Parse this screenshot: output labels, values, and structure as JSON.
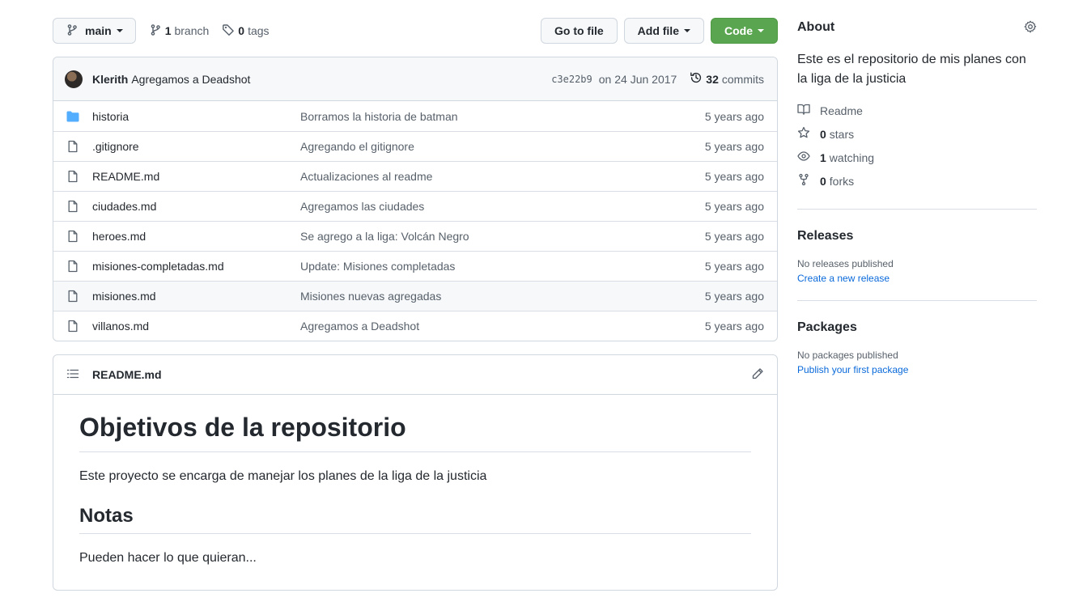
{
  "toolbar": {
    "branch_name": "main",
    "branch_count": "1",
    "branch_label": "branch",
    "tag_count": "0",
    "tag_label": "tags",
    "go_to_file": "Go to file",
    "add_file": "Add file",
    "code": "Code"
  },
  "latest_commit": {
    "author": "Klerith",
    "message": "Agregamos a Deadshot",
    "sha": "c3e22b9",
    "date": "on 24 Jun 2017",
    "commit_count": "32",
    "commit_label": "commits"
  },
  "files": [
    {
      "type": "dir",
      "name": "historia",
      "message": "Borramos la historia de batman",
      "age": "5 years ago"
    },
    {
      "type": "file",
      "name": ".gitignore",
      "message": "Agregando el gitignore",
      "age": "5 years ago"
    },
    {
      "type": "file",
      "name": "README.md",
      "message": "Actualizaciones al readme",
      "age": "5 years ago"
    },
    {
      "type": "file",
      "name": "ciudades.md",
      "message": "Agregamos las ciudades",
      "age": "5 years ago"
    },
    {
      "type": "file",
      "name": "heroes.md",
      "message": "Se agrego a la liga: Volcán Negro",
      "age": "5 years ago"
    },
    {
      "type": "file",
      "name": "misiones-completadas.md",
      "message": "Update: Misiones completadas",
      "age": "5 years ago"
    },
    {
      "type": "file",
      "name": "misiones.md",
      "message": "Misiones nuevas agregadas",
      "age": "5 years ago"
    },
    {
      "type": "file",
      "name": "villanos.md",
      "message": "Agregamos a Deadshot",
      "age": "5 years ago"
    }
  ],
  "readme": {
    "filename": "README.md",
    "h1": "Objetivos de la repositorio",
    "p1": "Este proyecto se encarga de manejar los planes de la liga de la justicia",
    "h2": "Notas",
    "p2": "Pueden hacer lo que quieran..."
  },
  "about": {
    "title": "About",
    "description": "Este es el repositorio de mis planes con la liga de la justicia",
    "readme_label": "Readme",
    "stars_count": "0",
    "stars_label": "stars",
    "watching_count": "1",
    "watching_label": "watching",
    "forks_count": "0",
    "forks_label": "forks"
  },
  "releases": {
    "title": "Releases",
    "empty": "No releases published",
    "link": "Create a new release"
  },
  "packages": {
    "title": "Packages",
    "empty": "No packages published",
    "link": "Publish your first package"
  },
  "colors": {
    "code_button": "#5aa54f",
    "folder": "#54aeff",
    "link": "#0969da"
  }
}
